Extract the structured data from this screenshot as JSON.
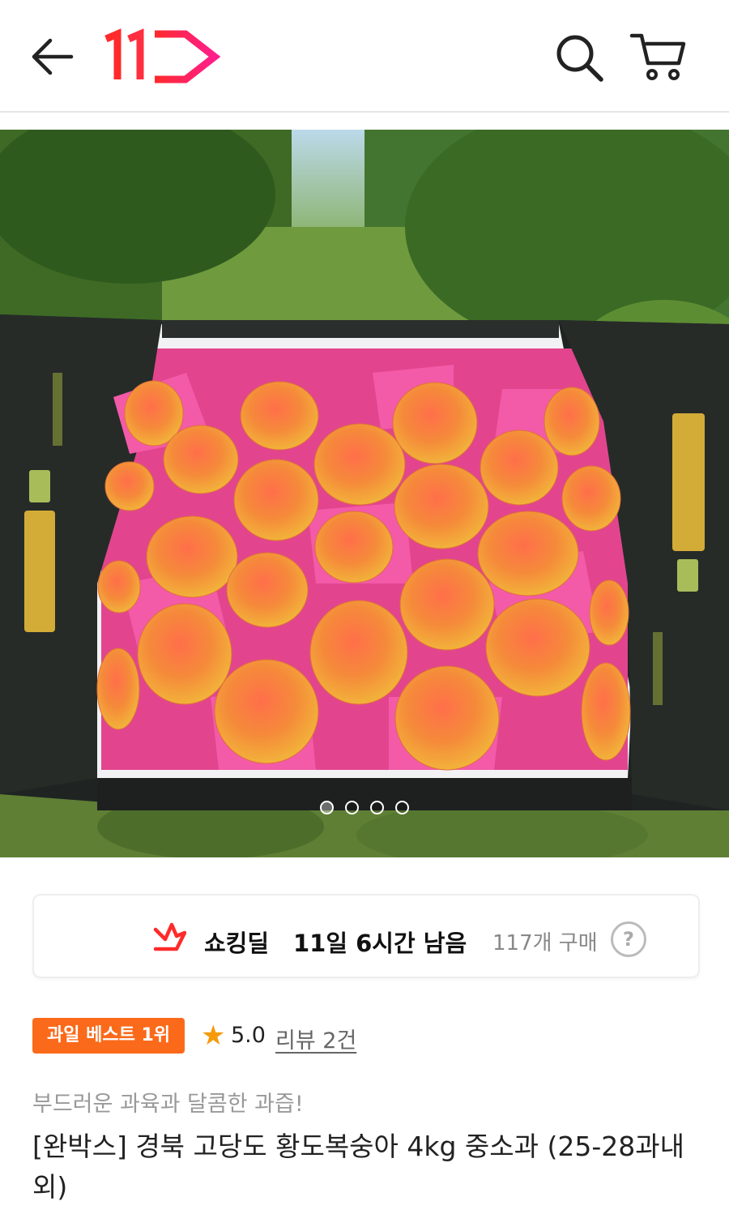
{
  "header": {
    "logo_text": "11",
    "icons": [
      "back-arrow-icon",
      "search-icon",
      "cart-icon"
    ],
    "brand_color": "#ff1f4b"
  },
  "hero": {
    "image_description_icon": "product-photo",
    "carousel": {
      "count": 4,
      "active_index": 0
    }
  },
  "deal": {
    "title": "쇼킹딜",
    "time_left": "11일 6시간 남음",
    "purchase_count": "117개 구매",
    "help_label": "?"
  },
  "badges": {
    "best": "과일 베스트 1위",
    "rating": "5.0",
    "review": "리뷰 2건",
    "accent_color": "#fb6a1a"
  },
  "product": {
    "subtitle": "부드러운 과육과 달콤한 과즙!",
    "title": "[완박스] 경북 고당도 황도복숭아 4kg 중소과 (25-28과내외)"
  }
}
